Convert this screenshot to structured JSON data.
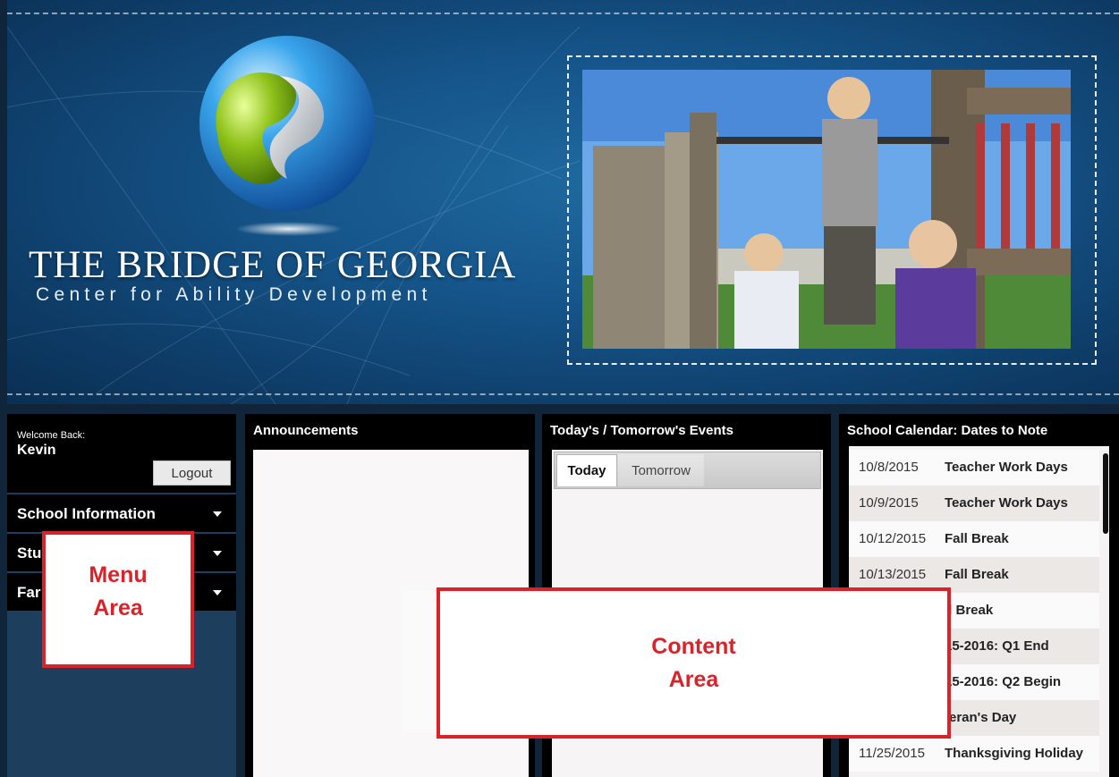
{
  "header": {
    "title": "THE BRIDGE OF GEORGIA",
    "subtitle": "Center for Ability Development",
    "logo_icon": "swirl-globe-logo-icon",
    "photo_icon": "playground-photo"
  },
  "sidebar": {
    "welcome_label": "Welcome Back:",
    "user_name": "Kevin",
    "logout_label": "Logout",
    "items": [
      {
        "label": "School Information"
      },
      {
        "label": "Stu"
      },
      {
        "label": "Far"
      }
    ]
  },
  "announcements": {
    "title": "Announcements"
  },
  "events": {
    "title": "Today's / Tomorrow's Events",
    "tabs": [
      "Today",
      "Tomorrow"
    ],
    "selected_tab": "Today"
  },
  "calendar": {
    "title": "School Calendar: Dates to Note",
    "rows": [
      {
        "date": "10/8/2015",
        "event": "Teacher Work Days"
      },
      {
        "date": "10/9/2015",
        "event": "Teacher Work Days"
      },
      {
        "date": "10/12/2015",
        "event": "Fall Break"
      },
      {
        "date": "10/13/2015",
        "event": "Fall Break"
      },
      {
        "date": "",
        "event": "ll Break"
      },
      {
        "date": "",
        "event": "15-2016: Q1 End"
      },
      {
        "date": "",
        "event": "15-2016: Q2 Begin"
      },
      {
        "date": "",
        "event": "teran's Day"
      },
      {
        "date": "11/25/2015",
        "event": "Thanksgiving Holiday"
      }
    ]
  },
  "annotations": {
    "menu_area": [
      "Menu",
      "Area"
    ],
    "content_area": [
      "Content",
      "Area"
    ]
  },
  "colors": {
    "header_blue": "#155489",
    "sidebar_navy": "#1d3e5c",
    "panel_black": "#000000",
    "callout_red": "#d8232a"
  }
}
